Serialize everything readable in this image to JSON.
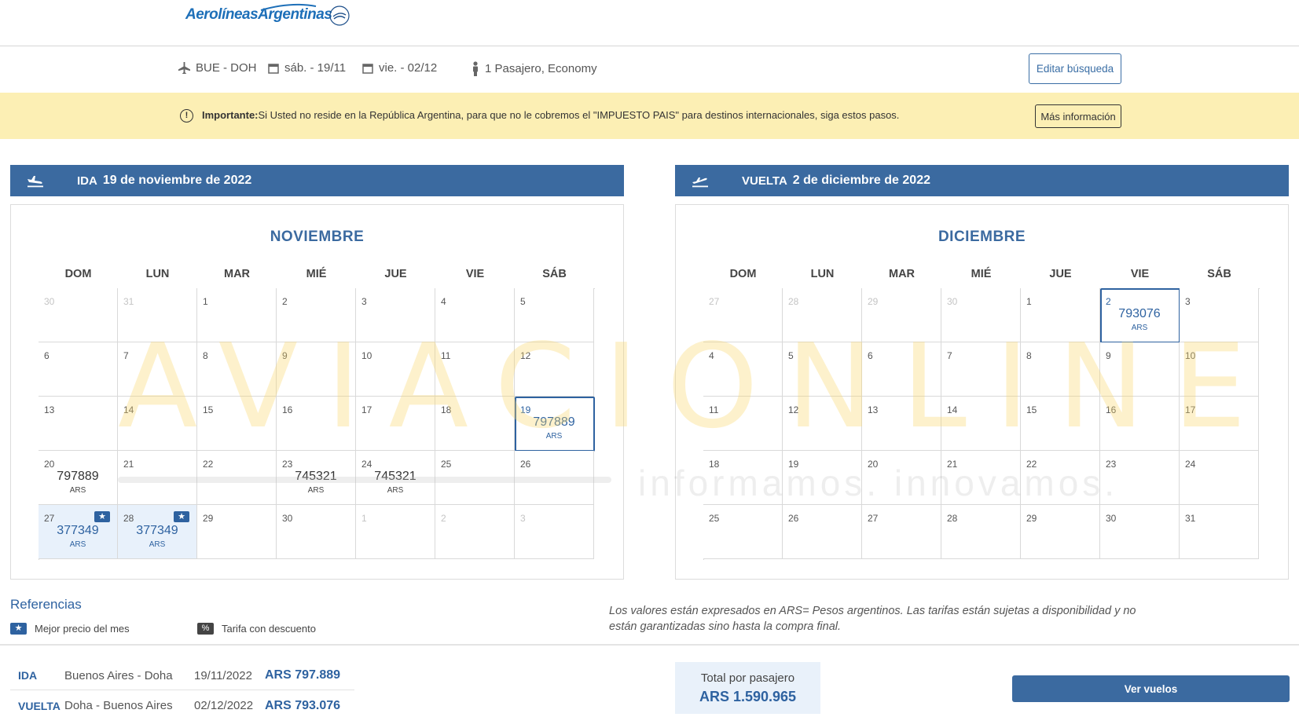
{
  "brand": {
    "name": "AerolíneasArgentinas",
    "alliance": "SkyTeam"
  },
  "summary": {
    "route": "BUE - DOH",
    "depart": "sáb. - 19/11",
    "return": "vie. - 02/12",
    "passengers": "1 Pasajero, Economy",
    "edit_label": "Editar búsqueda",
    "icons": [
      "plane-icon",
      "calendar-icon",
      "calendar-icon",
      "person-icon"
    ]
  },
  "notice": {
    "bold": "Importante:",
    "text": "Si Usted no reside en la República Argentina, para que no le cobremos el \"IMPUESTO PAIS\" para destinos internacionales, siga estos pasos.",
    "more_label": "Más información",
    "bg_color": "#fcefb4"
  },
  "ida": {
    "label": "IDA",
    "date": "19 de noviembre de 2022",
    "month": "NOVIEMBRE",
    "days_header": [
      "DOM",
      "LUN",
      "MAR",
      "MIÉ",
      "JUE",
      "VIE",
      "SÁB"
    ],
    "weeks": [
      [
        {
          "d": "30",
          "out": true
        },
        {
          "d": "31",
          "out": true
        },
        {
          "d": "1"
        },
        {
          "d": "2"
        },
        {
          "d": "3"
        },
        {
          "d": "4"
        },
        {
          "d": "5"
        }
      ],
      [
        {
          "d": "6"
        },
        {
          "d": "7"
        },
        {
          "d": "8"
        },
        {
          "d": "9"
        },
        {
          "d": "10"
        },
        {
          "d": "11"
        },
        {
          "d": "12"
        }
      ],
      [
        {
          "d": "13"
        },
        {
          "d": "14"
        },
        {
          "d": "15"
        },
        {
          "d": "16"
        },
        {
          "d": "17"
        },
        {
          "d": "18"
        },
        {
          "d": "19",
          "price": "797889",
          "cur": "ARS",
          "selected": true
        }
      ],
      [
        {
          "d": "20",
          "price": "797889",
          "cur": "ARS"
        },
        {
          "d": "21"
        },
        {
          "d": "22"
        },
        {
          "d": "23",
          "price": "745321",
          "cur": "ARS"
        },
        {
          "d": "24",
          "price": "745321",
          "cur": "ARS"
        },
        {
          "d": "25"
        },
        {
          "d": "26"
        }
      ],
      [
        {
          "d": "27",
          "price": "377349",
          "cur": "ARS",
          "best": true
        },
        {
          "d": "28",
          "price": "377349",
          "cur": "ARS",
          "best": true
        },
        {
          "d": "29"
        },
        {
          "d": "30"
        },
        {
          "d": "1",
          "out": true
        },
        {
          "d": "2",
          "out": true
        },
        {
          "d": "3",
          "out": true
        }
      ]
    ]
  },
  "vuelta": {
    "label": "VUELTA",
    "date": "2 de diciembre de 2022",
    "month": "DICIEMBRE",
    "days_header": [
      "DOM",
      "LUN",
      "MAR",
      "MIÉ",
      "JUE",
      "VIE",
      "SÁB"
    ],
    "weeks": [
      [
        {
          "d": "27",
          "out": true
        },
        {
          "d": "28",
          "out": true
        },
        {
          "d": "29",
          "out": true
        },
        {
          "d": "30",
          "out": true
        },
        {
          "d": "1"
        },
        {
          "d": "2",
          "price": "793076",
          "cur": "ARS",
          "selected": true
        },
        {
          "d": "3"
        }
      ],
      [
        {
          "d": "4"
        },
        {
          "d": "5"
        },
        {
          "d": "6"
        },
        {
          "d": "7"
        },
        {
          "d": "8"
        },
        {
          "d": "9"
        },
        {
          "d": "10"
        }
      ],
      [
        {
          "d": "11"
        },
        {
          "d": "12"
        },
        {
          "d": "13"
        },
        {
          "d": "14"
        },
        {
          "d": "15"
        },
        {
          "d": "16"
        },
        {
          "d": "17"
        }
      ],
      [
        {
          "d": "18"
        },
        {
          "d": "19"
        },
        {
          "d": "20"
        },
        {
          "d": "21"
        },
        {
          "d": "22"
        },
        {
          "d": "23"
        },
        {
          "d": "24"
        }
      ],
      [
        {
          "d": "25"
        },
        {
          "d": "26"
        },
        {
          "d": "27"
        },
        {
          "d": "28"
        },
        {
          "d": "29"
        },
        {
          "d": "30"
        },
        {
          "d": "31"
        }
      ]
    ]
  },
  "references": {
    "title": "Referencias",
    "best_label": "Mejor precio del mes",
    "discount_label": "Tarifa con descuento"
  },
  "disclaimer": "Los valores están expresados en ARS= Pesos argentinos. Las tarifas están sujetas a disponibilidad y no están garantizadas sino hasta la compra final.",
  "watermark": {
    "big": "AVIACIONLINE",
    "small": "informamos. innovamos."
  },
  "legs": [
    {
      "type": "IDA",
      "route": "Buenos Aires - Doha",
      "date": "19/11/2022",
      "amount": "ARS 797.889"
    },
    {
      "type": "VUELTA",
      "route": "Doha - Buenos Aires",
      "date": "02/12/2022",
      "amount": "ARS 793.076"
    }
  ],
  "total": {
    "label": "Total por pasajero",
    "amount": "ARS 1.590.965"
  },
  "cta": {
    "label": "Ver vuelos"
  },
  "colors": {
    "primary": "#3b6aa0",
    "accent": "#2e62a0",
    "best_bg": "#e8f1fb"
  }
}
